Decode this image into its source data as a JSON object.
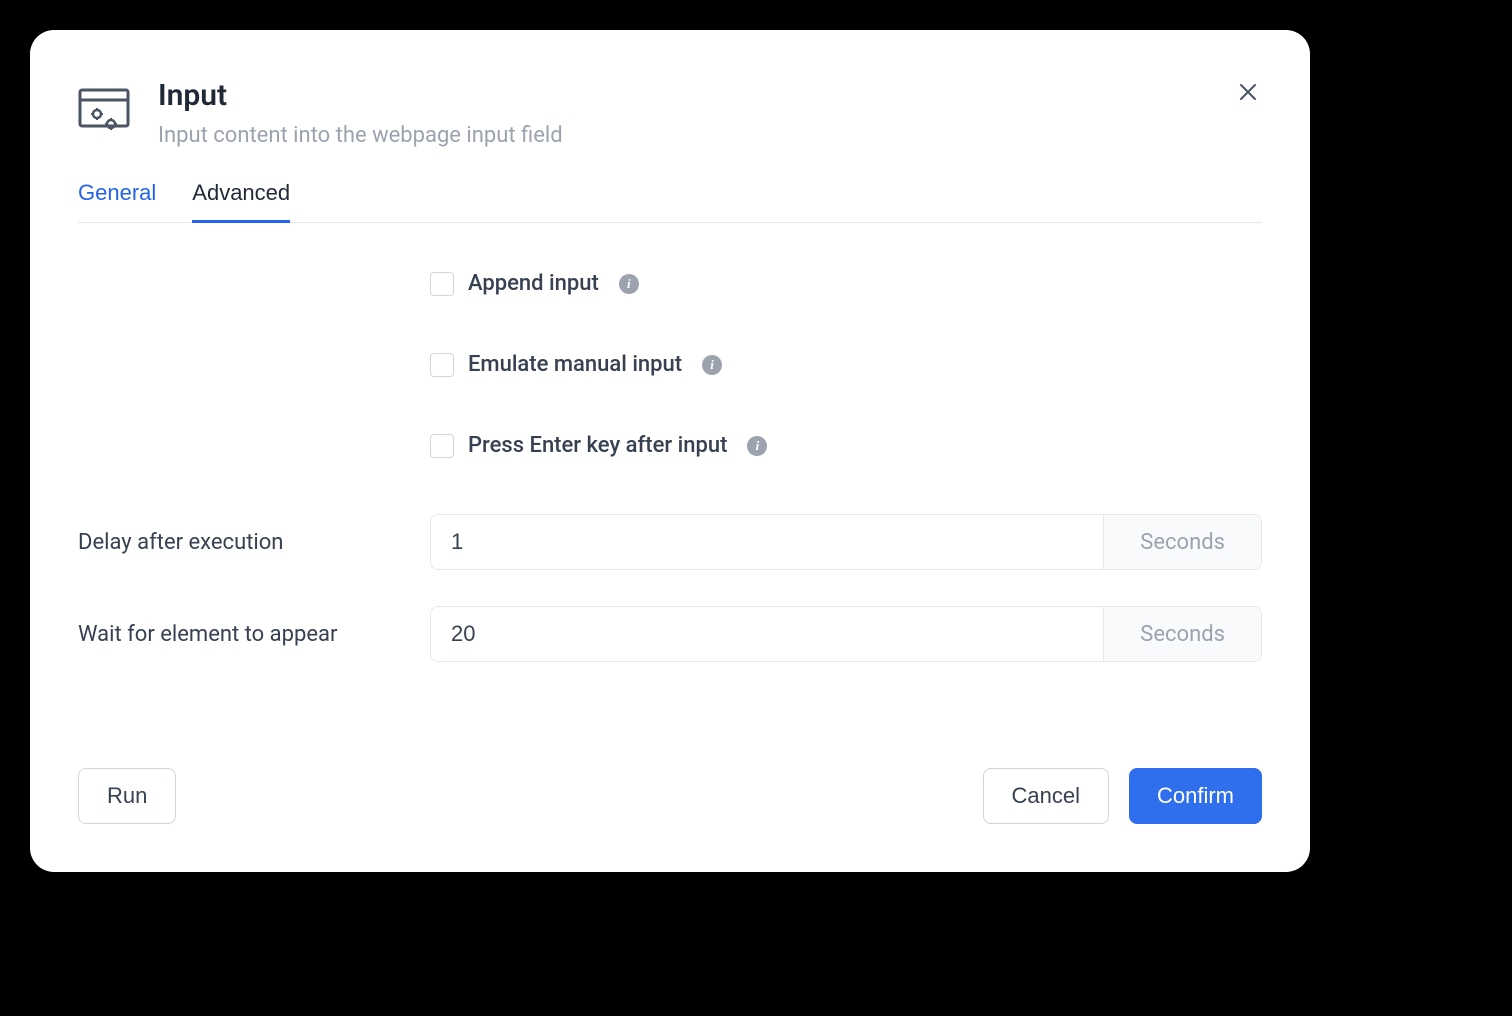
{
  "header": {
    "title": "Input",
    "subtitle": "Input content into the webpage input field"
  },
  "tabs": {
    "general": "General",
    "advanced": "Advanced"
  },
  "form": {
    "append_input_label": "Append input",
    "emulate_manual_label": "Emulate manual input",
    "press_enter_label": "Press Enter key after input",
    "delay_label": "Delay after execution",
    "delay_value": "1",
    "delay_unit": "Seconds",
    "wait_label": "Wait for element to appear",
    "wait_value": "20",
    "wait_unit": "Seconds"
  },
  "footer": {
    "run": "Run",
    "cancel": "Cancel",
    "confirm": "Confirm"
  },
  "info_glyph": "i"
}
